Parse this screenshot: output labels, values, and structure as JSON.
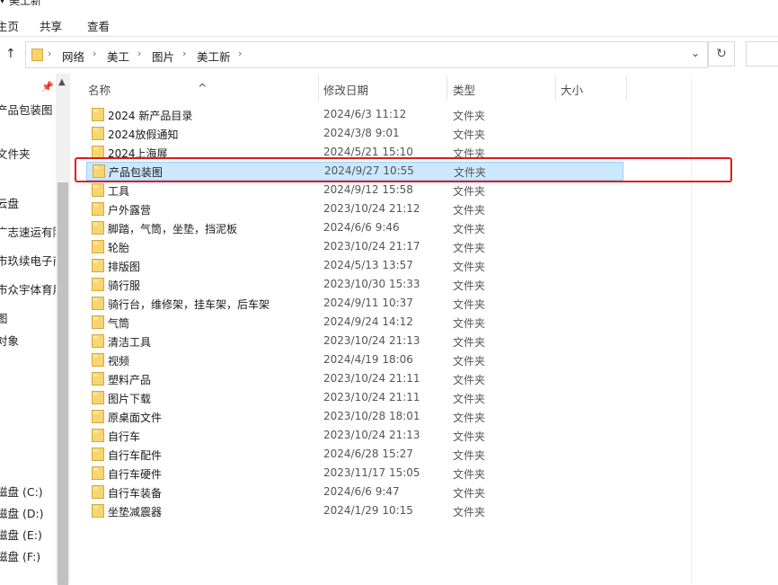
{
  "window": {
    "title": "美工新"
  },
  "ribbon": {
    "tabs": [
      "主页",
      "共享",
      "查看"
    ]
  },
  "address": {
    "crumbs": [
      "网络",
      "美工",
      "图片",
      "美工新"
    ]
  },
  "nav": {
    "items": [
      "产品包装图",
      "文件夹",
      "云盘",
      "广志速运有限",
      "市玖续电子商",
      "市众宇体育用",
      "图",
      "对象",
      "磁盘 (C:)",
      "磁盘 (D:)",
      "磁盘 (E:)",
      "磁盘 (F:)"
    ]
  },
  "columns": {
    "name": "名称",
    "date": "修改日期",
    "type": "类型",
    "size": "大小"
  },
  "files": [
    {
      "name": "2024 新产品目录",
      "date": "2024/6/3 11:12",
      "type": "文件夹"
    },
    {
      "name": "2024放假通知",
      "date": "2024/3/8 9:01",
      "type": "文件夹"
    },
    {
      "name": "2024上海展",
      "date": "2024/5/21 15:10",
      "type": "文件夹"
    },
    {
      "name": "产品包装图",
      "date": "2024/9/27 10:55",
      "type": "文件夹"
    },
    {
      "name": "工具",
      "date": "2024/9/12 15:58",
      "type": "文件夹"
    },
    {
      "name": "户外露营",
      "date": "2023/10/24 21:12",
      "type": "文件夹"
    },
    {
      "name": "脚踏，气筒，坐垫，挡泥板",
      "date": "2024/6/6 9:46",
      "type": "文件夹"
    },
    {
      "name": "轮胎",
      "date": "2023/10/24 21:17",
      "type": "文件夹"
    },
    {
      "name": "排版图",
      "date": "2024/5/13 13:57",
      "type": "文件夹"
    },
    {
      "name": "骑行服",
      "date": "2023/10/30 15:33",
      "type": "文件夹"
    },
    {
      "name": "骑行台，维修架，挂车架，后车架",
      "date": "2024/9/11 10:37",
      "type": "文件夹"
    },
    {
      "name": "气筒",
      "date": "2024/9/24 14:12",
      "type": "文件夹"
    },
    {
      "name": "清洁工具",
      "date": "2023/10/24 21:13",
      "type": "文件夹"
    },
    {
      "name": "视频",
      "date": "2024/4/19 18:06",
      "type": "文件夹"
    },
    {
      "name": "塑料产品",
      "date": "2023/10/24 21:11",
      "type": "文件夹"
    },
    {
      "name": "图片下载",
      "date": "2023/10/24 21:11",
      "type": "文件夹"
    },
    {
      "name": "原桌面文件",
      "date": "2023/10/28 18:01",
      "type": "文件夹"
    },
    {
      "name": "自行车",
      "date": "2023/10/24 21:13",
      "type": "文件夹"
    },
    {
      "name": "自行车配件",
      "date": "2024/6/28 15:27",
      "type": "文件夹"
    },
    {
      "name": "自行车硬件",
      "date": "2023/11/17 15:05",
      "type": "文件夹"
    },
    {
      "name": "自行车装备",
      "date": "2024/6/6 9:47",
      "type": "文件夹"
    },
    {
      "name": "坐垫减震器",
      "date": "2024/1/29 10:15",
      "type": "文件夹"
    }
  ],
  "selected_index": 3,
  "colors": {
    "selection_bg": "#cce8ff",
    "selection_border": "#99d1ff",
    "highlight_box": "#e31b1b",
    "folder": "#f7d571"
  }
}
